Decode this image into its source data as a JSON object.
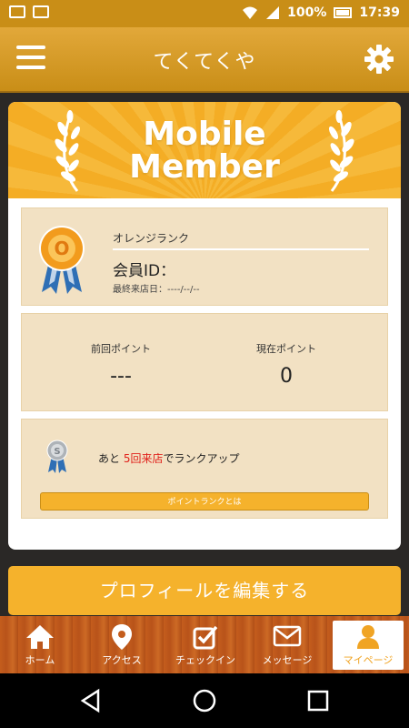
{
  "status_bar": {
    "battery": "100%",
    "time": "17:39"
  },
  "app_bar": {
    "title": "てくてくや"
  },
  "banner": {
    "line1": "Mobile",
    "line2": "Member"
  },
  "rank": {
    "name": "オレンジランク",
    "member_id_label": "会員ID：",
    "last_visit_label": "最終来店日：----/--/--",
    "medal_letter": "O",
    "medal_color": "#f29b1d"
  },
  "points": {
    "previous_label": "前回ポイント",
    "previous_value": "---",
    "current_label": "現在ポイント",
    "current_value": "0"
  },
  "rank_up": {
    "prefix": "あと ",
    "highlight": "5回来店",
    "suffix": "でランクアップ",
    "next_medal_letter": "S",
    "button_label": "ポイントランクとは"
  },
  "edit_profile_label": "プロフィールを編集する",
  "tabs": [
    {
      "label": "ホーム",
      "icon": "home-icon"
    },
    {
      "label": "アクセス",
      "icon": "map-pin-icon"
    },
    {
      "label": "チェックイン",
      "icon": "checkin-icon"
    },
    {
      "label": "メッセージ",
      "icon": "mail-icon"
    },
    {
      "label": "マイページ",
      "icon": "person-icon",
      "active": true
    }
  ],
  "colors": {
    "accent": "#f5b22c",
    "tab_wood": "#c45d1d",
    "highlight_red": "#e0201a"
  }
}
